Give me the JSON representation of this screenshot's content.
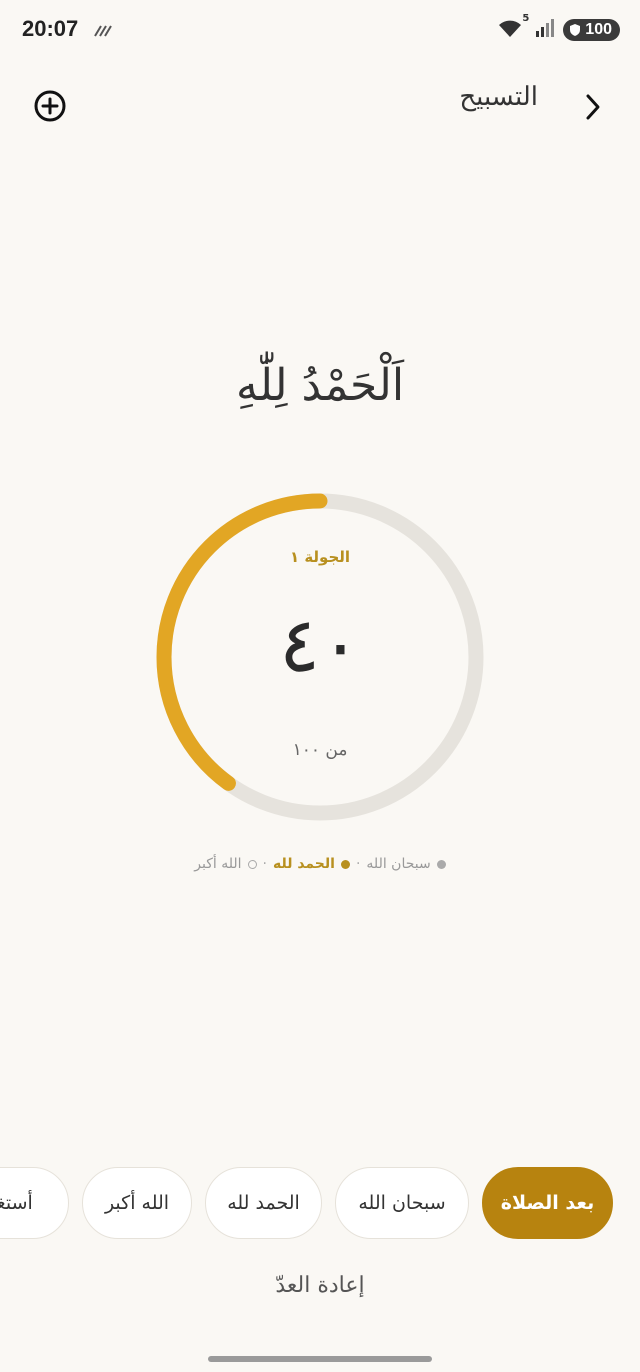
{
  "status_bar": {
    "time": "20:07",
    "battery": "100",
    "network_badge": "5",
    "icons": [
      "wifi-icon",
      "signal-icon",
      "battery-icon"
    ]
  },
  "header": {
    "title": "التسبيح",
    "add_icon": "plus-circle-icon",
    "back_icon": "chevron-right-icon"
  },
  "dhikr": {
    "current_text": "اَلْحَمْدُ لِلّٰهِ",
    "round_label": "الجولة ١",
    "count": "٤٠",
    "of_total": "من ١٠٠",
    "progress_fraction": 0.4
  },
  "legend": {
    "items": [
      {
        "label": "سبحان الله",
        "state": "done"
      },
      {
        "label": "الحمد لله",
        "state": "active"
      },
      {
        "label": "الله أكبر",
        "state": "pending"
      }
    ],
    "separator": "·"
  },
  "chips": [
    {
      "label": "بعد الصلاة",
      "active": true
    },
    {
      "label": "سبحان الله",
      "active": false
    },
    {
      "label": "الحمد لله",
      "active": false
    },
    {
      "label": "الله أكبر",
      "active": false
    },
    {
      "label": "أستغفر الله",
      "active": false
    }
  ],
  "reset_label": "إعادة العدّ",
  "colors": {
    "accent": "#B7830F",
    "ring_progress": "#E2A624",
    "ring_track": "#E6E3DD",
    "background": "#FAF8F4"
  }
}
